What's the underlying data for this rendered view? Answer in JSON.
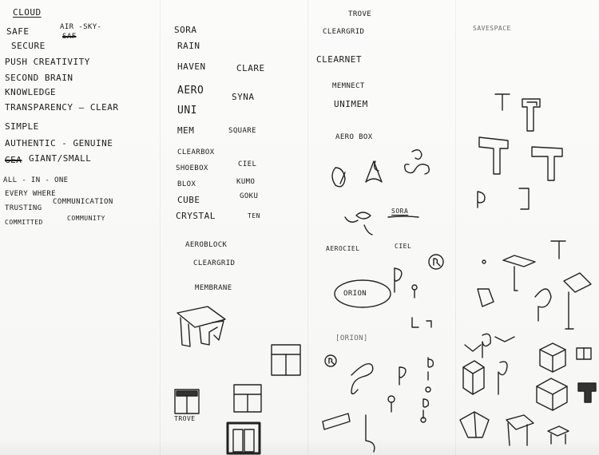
{
  "col1": {
    "title": "CLOUD",
    "words": {
      "safe": "SAFE",
      "secure": "SECURE",
      "air_sky": "AIR -SKY-",
      "strike": "SAF",
      "push_creativity": "PUSH CREATIVITY",
      "second_brain": "SECOND BRAIN",
      "knowledge": "KNOWLEDGE",
      "transparency": "TRANSPARENCY — CLEAR",
      "simple": "SIMPLE",
      "authentic": "AUTHENTIC - GENUINE",
      "giant_small": "GIANT/SMALL",
      "giant_strike": "GEA",
      "all_in_one": "ALL - IN - ONE",
      "everywhere": "EVERY WHERE",
      "trusting": "TRUSTING",
      "communication": "COMMUNICATION",
      "committed": "COMMITTED",
      "community": "COMMUNITY"
    }
  },
  "col2": {
    "words": {
      "sora": "SORA",
      "rain": "RAIN",
      "haven": "HAVEN",
      "clare": "CLARE",
      "aero": "AERO",
      "syna": "SYNA",
      "uni": "UNI",
      "mem": "MEM",
      "square": "SQUARE",
      "clearbox": "CLEARBOX",
      "shoebox": "SHOEBOX",
      "ciel": "CIEL",
      "blox": "BLOX",
      "kumo": "KUMO",
      "cube": "CUBE",
      "goku": "GOKU",
      "crystal": "CRYSTAL",
      "ten": "TEN"
    },
    "lower": {
      "aeroblock": "AEROBLOCK",
      "cleargrid": "CLEARGRID",
      "membrane": "MEMBRANE",
      "trove": "TROVE"
    }
  },
  "col3": {
    "words": {
      "trove": "TROVE",
      "cleargrid": "CLEARGRID",
      "clearnet": "CLEARNET",
      "memnect": "MEMNECT",
      "unimem": "UNIMEM",
      "aero_box": "AERO BOX",
      "sora": "SORA",
      "aerociel": "AEROCIEL",
      "ciel": "CIEL",
      "orion": "ORION",
      "orion_bracket": "[ORION]"
    }
  },
  "col4": {
    "words": {
      "savespace": "SAVESPACE"
    }
  }
}
